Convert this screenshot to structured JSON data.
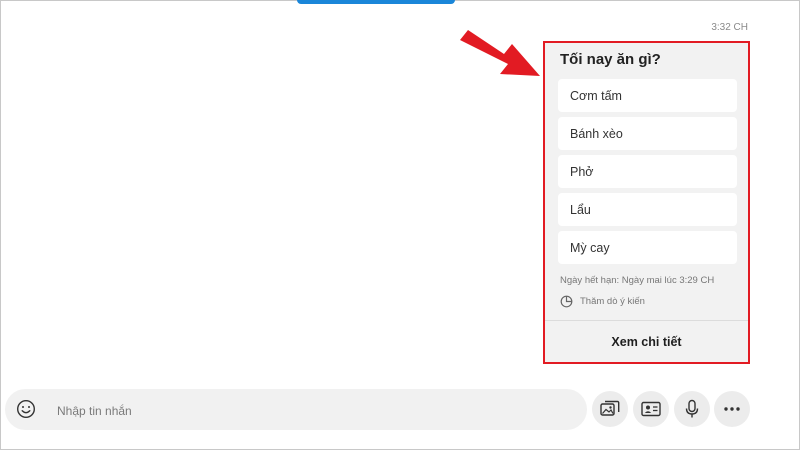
{
  "message": {
    "timestamp": "3:32 CH"
  },
  "poll": {
    "title": "Tối nay ăn gì?",
    "options": [
      "Cơm tấm",
      "Bánh xèo",
      "Phở",
      "Lẩu",
      "Mỳ cay"
    ],
    "expiry": "Ngày hết hạn: Ngày mai lúc 3:29 CH",
    "type_label": "Thăm dò ý kiến",
    "details_button": "Xem chi tiết"
  },
  "composer": {
    "placeholder": "Nhập tin nhắn"
  },
  "icons": {
    "emoji": "smiley-icon",
    "poll": "pie-chart-icon",
    "media": "image-gallery-icon",
    "contact": "contact-card-icon",
    "mic": "microphone-icon",
    "more": "more-horizontal-icon",
    "annotation": "red-arrow-icon"
  },
  "colors": {
    "highlight_border": "#e21b23",
    "arrow": "#e21b23",
    "accent": "#1a86d9"
  }
}
